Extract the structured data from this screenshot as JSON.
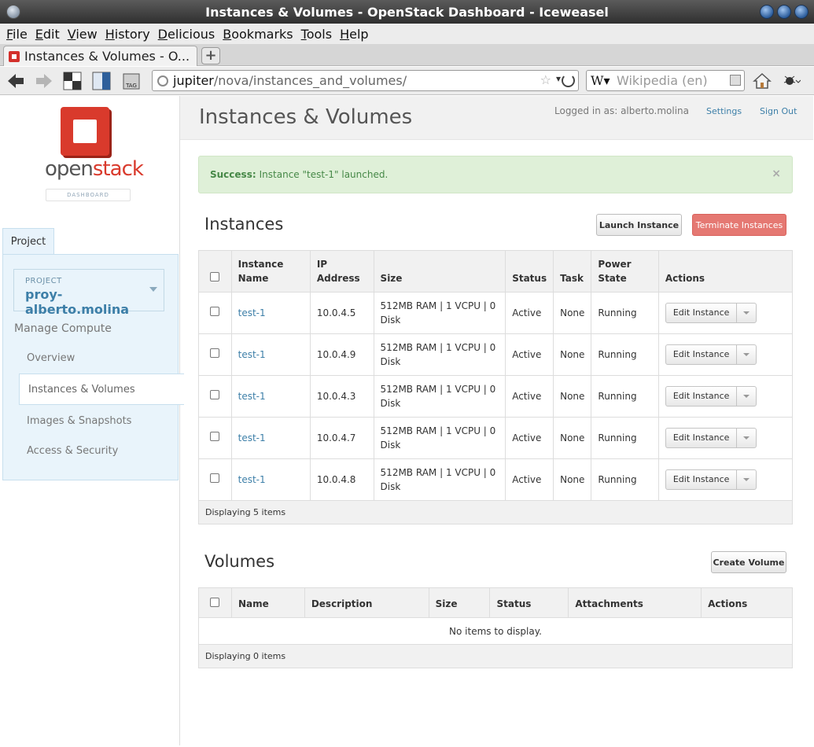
{
  "window": {
    "title": "Instances & Volumes - OpenStack Dashboard - Iceweasel"
  },
  "menu": [
    "File",
    "Edit",
    "View",
    "History",
    "Delicious",
    "Bookmarks",
    "Tools",
    "Help"
  ],
  "tab": {
    "label": "Instances & Volumes - O..."
  },
  "url": {
    "host": "jupiter",
    "path": "/nova/instances_and_volumes/"
  },
  "search": {
    "placeholder": "Wikipedia (en)",
    "engine": "W"
  },
  "sidebar": {
    "brand_open": "open",
    "brand_stack": "stack",
    "brand_sub": "DASHBOARD",
    "tab_label": "Project",
    "project_label": "PROJECT",
    "project_value": "proy-alberto.molina",
    "section": "Manage Compute",
    "items": [
      {
        "label": "Overview",
        "active": false
      },
      {
        "label": "Instances & Volumes",
        "active": true
      },
      {
        "label": "Images & Snapshots",
        "active": false
      },
      {
        "label": "Access & Security",
        "active": false
      }
    ]
  },
  "header": {
    "title": "Instances & Volumes",
    "logged_in": "Logged in as: alberto.molina",
    "settings": "Settings",
    "sign_out": "Sign Out"
  },
  "alert": {
    "strong": "Success:",
    "text": "Instance \"test-1\" launched.",
    "close": "×"
  },
  "instances": {
    "title": "Instances",
    "launch_button": "Launch Instance",
    "terminate_button": "Terminate Instances",
    "columns": [
      "Instance Name",
      "IP Address",
      "Size",
      "Status",
      "Task",
      "Power State",
      "Actions"
    ],
    "rows": [
      {
        "name": "test-1",
        "ip": "10.0.4.5",
        "size": "512MB RAM | 1 VCPU | 0 Disk",
        "status": "Active",
        "task": "None",
        "power": "Running",
        "action": "Edit Instance"
      },
      {
        "name": "test-1",
        "ip": "10.0.4.9",
        "size": "512MB RAM | 1 VCPU | 0 Disk",
        "status": "Active",
        "task": "None",
        "power": "Running",
        "action": "Edit Instance"
      },
      {
        "name": "test-1",
        "ip": "10.0.4.3",
        "size": "512MB RAM | 1 VCPU | 0 Disk",
        "status": "Active",
        "task": "None",
        "power": "Running",
        "action": "Edit Instance"
      },
      {
        "name": "test-1",
        "ip": "10.0.4.7",
        "size": "512MB RAM | 1 VCPU | 0 Disk",
        "status": "Active",
        "task": "None",
        "power": "Running",
        "action": "Edit Instance"
      },
      {
        "name": "test-1",
        "ip": "10.0.4.8",
        "size": "512MB RAM | 1 VCPU | 0 Disk",
        "status": "Active",
        "task": "None",
        "power": "Running",
        "action": "Edit Instance"
      }
    ],
    "footer": "Displaying 5 items"
  },
  "volumes": {
    "title": "Volumes",
    "create_button": "Create Volume",
    "columns": [
      "Name",
      "Description",
      "Size",
      "Status",
      "Attachments",
      "Actions"
    ],
    "empty": "No items to display.",
    "footer": "Displaying 0 items"
  },
  "colors": {
    "link": "#3d7fa8",
    "success_bg": "#dff0d8",
    "success_text": "#468847",
    "danger": "#e57872",
    "brand_red": "#d93a2c"
  }
}
